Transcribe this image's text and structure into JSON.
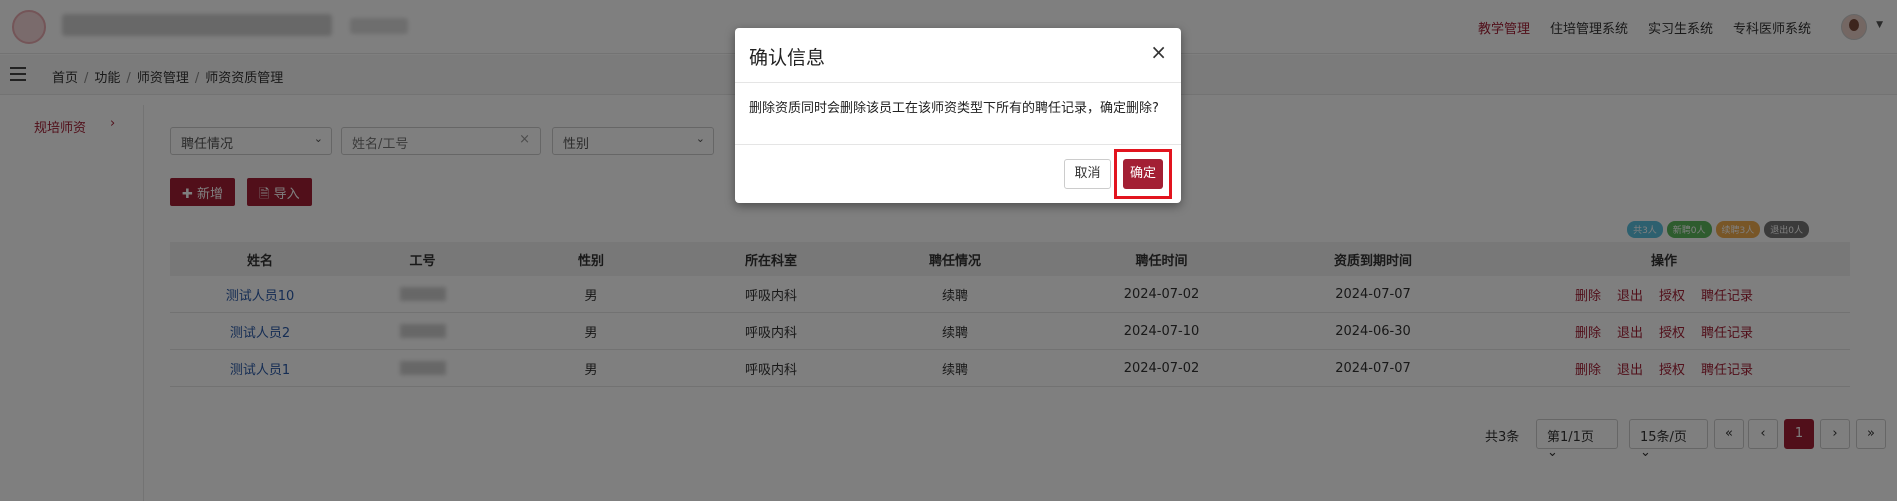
{
  "header": {
    "menu": [
      "教学管理",
      "住培管理系统",
      "实习生系统",
      "专科医师系统"
    ],
    "active_index": 0
  },
  "breadcrumb": [
    "首页",
    "功能",
    "师资管理",
    "师资资质管理"
  ],
  "sidebar": {
    "items": [
      {
        "label": "规培师资"
      }
    ]
  },
  "filters": {
    "employment": "聘任情况",
    "name_placeholder": "姓名/工号",
    "gender": "性别"
  },
  "toolbar": {
    "add_label": "新增",
    "import_label": "导入"
  },
  "stats": [
    {
      "label": "共3人",
      "color": "#5bc0de"
    },
    {
      "label": "新聘0人",
      "color": "#5cb85c"
    },
    {
      "label": "续聘3人",
      "color": "#f0ad4e"
    },
    {
      "label": "退出0人",
      "color": "#777777"
    }
  ],
  "table": {
    "columns": [
      "姓名",
      "工号",
      "性别",
      "所在科室",
      "聘任情况",
      "聘任时间",
      "资质到期时间",
      "操作"
    ],
    "rows": [
      {
        "name": "测试人员10",
        "gender": "男",
        "dept": "呼吸内科",
        "status": "续聘",
        "hire_date": "2024-07-02",
        "expire_date": "2024-07-07"
      },
      {
        "name": "测试人员2",
        "gender": "男",
        "dept": "呼吸内科",
        "status": "续聘",
        "hire_date": "2024-07-10",
        "expire_date": "2024-06-30"
      },
      {
        "name": "测试人员1",
        "gender": "男",
        "dept": "呼吸内科",
        "status": "续聘",
        "hire_date": "2024-07-02",
        "expire_date": "2024-07-07"
      }
    ],
    "actions": [
      "删除",
      "退出",
      "授权",
      "聘任记录"
    ]
  },
  "pagination": {
    "total": "共3条",
    "page": "第1/1页",
    "page_size": "15条/页",
    "current": "1",
    "first": "«",
    "prev": "‹",
    "next": "›",
    "last": "»"
  },
  "modal": {
    "title": "确认信息",
    "close": "×",
    "message": "删除资质同时会删除该员工在该师资类型下所有的聘任记录，确定删除?",
    "cancel_label": "取消",
    "confirm_label": "确定"
  },
  "colors": {
    "brand": "#a31f34",
    "link": "#2b5aa8",
    "highlight": "#e2141e"
  }
}
